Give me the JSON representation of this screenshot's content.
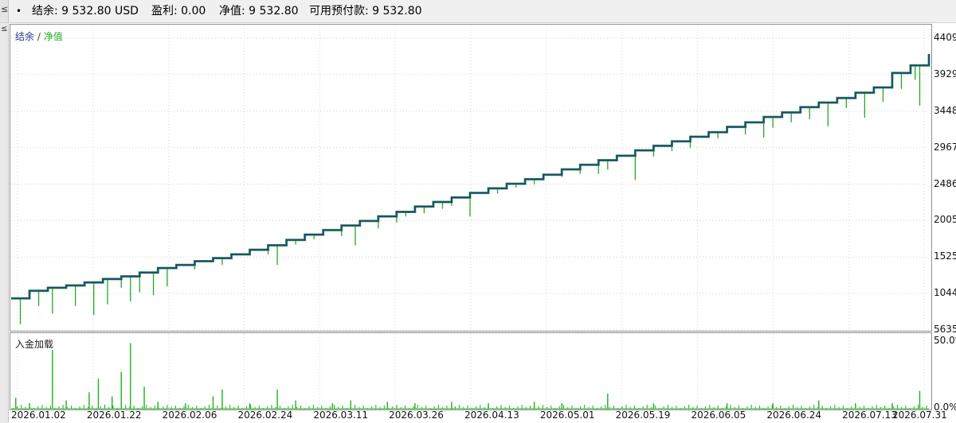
{
  "header": {
    "bullet": "•",
    "balance": "结余: 9 532.80 USD",
    "profit": "盈利: 0.00",
    "equity": "净值: 9 532.80",
    "free_margin": "可用预付款: 9 532.80",
    "corner_glyph": "≤"
  },
  "left_strip": {
    "glyph": "≤"
  },
  "chart_data": [
    {
      "type": "line",
      "legend": [
        "结余",
        "/",
        "净值"
      ],
      "series": [
        {
          "name": "结余",
          "color": "#2b3990",
          "role": "balance"
        },
        {
          "name": "净值",
          "color": "#22aa22",
          "role": "equity"
        }
      ],
      "x_tick_labels": [
        "2026.01.02",
        "2026.01.22",
        "2026.02.06",
        "2026.02.24",
        "2026.03.11",
        "2026.03.26",
        "2026.04.13",
        "2026.05.01",
        "2026.05.19",
        "2026.06.05",
        "2026.06.24",
        "2026.07.13",
        "2026.07.31"
      ],
      "y_tick_labels": [
        "4409",
        "3929",
        "3448",
        "2967",
        "2486",
        "2005",
        "1525",
        "1044",
        "5635"
      ],
      "y_tick_values": [
        4409,
        3929,
        3448,
        2967,
        2486,
        2005,
        1525,
        1044,
        563.5
      ],
      "ylim": [
        563.5,
        4409
      ],
      "balance_points": [
        [
          0,
          980
        ],
        [
          0.02,
          1080
        ],
        [
          0.04,
          1120
        ],
        [
          0.06,
          1150
        ],
        [
          0.08,
          1190
        ],
        [
          0.1,
          1235
        ],
        [
          0.12,
          1270
        ],
        [
          0.14,
          1320
        ],
        [
          0.16,
          1380
        ],
        [
          0.18,
          1420
        ],
        [
          0.2,
          1470
        ],
        [
          0.22,
          1510
        ],
        [
          0.24,
          1560
        ],
        [
          0.26,
          1620
        ],
        [
          0.28,
          1680
        ],
        [
          0.3,
          1750
        ],
        [
          0.32,
          1820
        ],
        [
          0.34,
          1880
        ],
        [
          0.36,
          1940
        ],
        [
          0.38,
          2000
        ],
        [
          0.4,
          2060
        ],
        [
          0.42,
          2120
        ],
        [
          0.44,
          2190
        ],
        [
          0.46,
          2250
        ],
        [
          0.48,
          2310
        ],
        [
          0.5,
          2370
        ],
        [
          0.52,
          2430
        ],
        [
          0.54,
          2490
        ],
        [
          0.56,
          2550
        ],
        [
          0.58,
          2610
        ],
        [
          0.6,
          2680
        ],
        [
          0.62,
          2740
        ],
        [
          0.64,
          2800
        ],
        [
          0.66,
          2860
        ],
        [
          0.68,
          2930
        ],
        [
          0.7,
          2990
        ],
        [
          0.72,
          3050
        ],
        [
          0.74,
          3110
        ],
        [
          0.76,
          3170
        ],
        [
          0.78,
          3240
        ],
        [
          0.8,
          3300
        ],
        [
          0.82,
          3370
        ],
        [
          0.84,
          3430
        ],
        [
          0.86,
          3500
        ],
        [
          0.88,
          3560
        ],
        [
          0.9,
          3620
        ],
        [
          0.92,
          3690
        ],
        [
          0.94,
          3760
        ],
        [
          0.96,
          3950
        ],
        [
          0.98,
          4050
        ],
        [
          1.0,
          4200
        ]
      ],
      "equity_drawdowns": [
        [
          0.01,
          640
        ],
        [
          0.03,
          880
        ],
        [
          0.045,
          780
        ],
        [
          0.07,
          880
        ],
        [
          0.09,
          760
        ],
        [
          0.105,
          900
        ],
        [
          0.12,
          1120
        ],
        [
          0.13,
          940
        ],
        [
          0.14,
          1060
        ],
        [
          0.155,
          1020
        ],
        [
          0.17,
          1140
        ],
        [
          0.2,
          1360
        ],
        [
          0.23,
          1420
        ],
        [
          0.26,
          1550
        ],
        [
          0.28,
          1560
        ],
        [
          0.29,
          1420
        ],
        [
          0.31,
          1690
        ],
        [
          0.33,
          1760
        ],
        [
          0.36,
          1800
        ],
        [
          0.375,
          1680
        ],
        [
          0.4,
          1900
        ],
        [
          0.42,
          1980
        ],
        [
          0.43,
          2060
        ],
        [
          0.45,
          2100
        ],
        [
          0.47,
          2160
        ],
        [
          0.48,
          2200
        ],
        [
          0.5,
          2060
        ],
        [
          0.53,
          2360
        ],
        [
          0.55,
          2440
        ],
        [
          0.57,
          2480
        ],
        [
          0.6,
          2580
        ],
        [
          0.62,
          2620
        ],
        [
          0.64,
          2620
        ],
        [
          0.65,
          2680
        ],
        [
          0.68,
          2540
        ],
        [
          0.7,
          2850
        ],
        [
          0.72,
          2920
        ],
        [
          0.74,
          2960
        ],
        [
          0.77,
          3090
        ],
        [
          0.8,
          3140
        ],
        [
          0.82,
          3100
        ],
        [
          0.83,
          3230
        ],
        [
          0.85,
          3300
        ],
        [
          0.87,
          3340
        ],
        [
          0.89,
          3250
        ],
        [
          0.91,
          3490
        ],
        [
          0.93,
          3360
        ],
        [
          0.95,
          3570
        ],
        [
          0.97,
          3740
        ],
        [
          0.985,
          3860
        ],
        [
          0.99,
          3520
        ]
      ]
    },
    {
      "type": "bar",
      "label": "入金加载",
      "y_tick_labels": [
        "50.0%",
        "0.0%"
      ],
      "ylim": [
        0,
        50
      ],
      "spikes": [
        [
          0.005,
          8
        ],
        [
          0.02,
          4
        ],
        [
          0.045,
          43
        ],
        [
          0.06,
          6
        ],
        [
          0.085,
          12
        ],
        [
          0.095,
          22
        ],
        [
          0.11,
          9
        ],
        [
          0.12,
          27
        ],
        [
          0.13,
          48
        ],
        [
          0.145,
          16
        ],
        [
          0.16,
          5
        ],
        [
          0.19,
          4
        ],
        [
          0.22,
          9
        ],
        [
          0.23,
          14
        ],
        [
          0.26,
          4
        ],
        [
          0.29,
          14
        ],
        [
          0.31,
          6
        ],
        [
          0.35,
          4
        ],
        [
          0.37,
          6
        ],
        [
          0.41,
          5
        ],
        [
          0.44,
          4
        ],
        [
          0.48,
          5
        ],
        [
          0.52,
          4
        ],
        [
          0.57,
          5
        ],
        [
          0.6,
          4
        ],
        [
          0.65,
          11
        ],
        [
          0.7,
          4
        ],
        [
          0.78,
          4
        ],
        [
          0.83,
          4
        ],
        [
          0.88,
          6
        ],
        [
          0.92,
          4
        ],
        [
          0.96,
          4
        ],
        [
          0.99,
          13
        ]
      ]
    }
  ]
}
